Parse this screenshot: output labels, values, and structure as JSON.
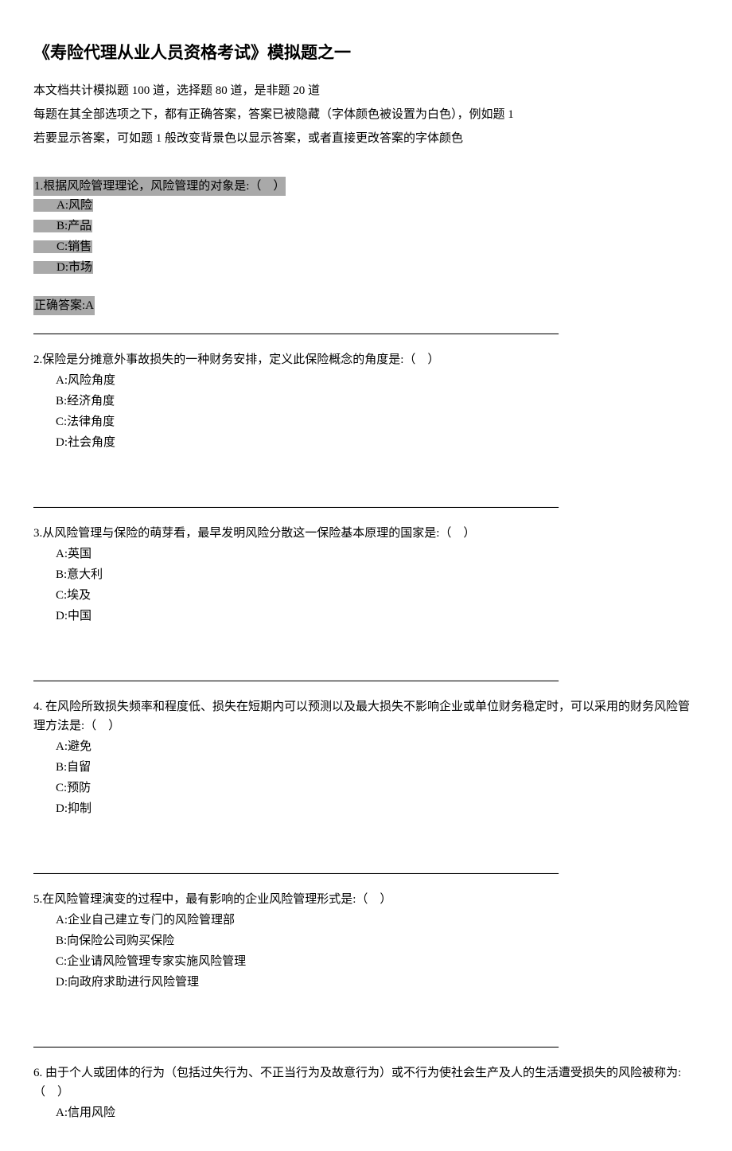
{
  "title": "《寿险代理从业人员资格考试》模拟题之一",
  "intro": {
    "line1": "本文档共计模拟题 100 道，选择题 80 道，是非题 20 道",
    "line2": "每题在其全部选项之下，都有正确答案，答案已被隐藏（字体颜色被设置为白色），例如题 1",
    "line3": "若要显示答案，可如题 1 般改变背景色以显示答案，或者直接更改答案的字体颜色"
  },
  "q1": {
    "text": "1.根据风险管理理论，风险管理的对象是:（ ）",
    "optA": "A:风险",
    "optB": "B:产品",
    "optC": "C:销售",
    "optD": "D:市场",
    "answer": "正确答案:A"
  },
  "q2": {
    "text": "2.保险是分摊意外事故损失的一种财务安排，定义此保险概念的角度是:（ ）",
    "optA": "A:风险角度",
    "optB": "B:经济角度",
    "optC": "C:法律角度",
    "optD": "D:社会角度"
  },
  "q3": {
    "text": "3.从风险管理与保险的萌芽看，最早发明风险分散这一保险基本原理的国家是:（ ）",
    "optA": "A:英国",
    "optB": "B:意大利",
    "optC": "C:埃及",
    "optD": "D:中国"
  },
  "q4": {
    "text": "4. 在风险所致损失频率和程度低、损失在短期内可以预测以及最大损失不影响企业或单位财务稳定时，可以采用的财务风险管理方法是:（ ）",
    "optA": "A:避免",
    "optB": "B:自留",
    "optC": "C:预防",
    "optD": "D:抑制"
  },
  "q5": {
    "text": "5.在风险管理演变的过程中，最有影响的企业风险管理形式是:（ ）",
    "optA": "A:企业自己建立专门的风险管理部",
    "optB": "B:向保险公司购买保险",
    "optC": "C:企业请风险管理专家实施风险管理",
    "optD": "D:向政府求助进行风险管理"
  },
  "q6": {
    "text": "6. 由于个人或团体的行为（包括过失行为、不正当行为及故意行为）或不行为使社会生产及人的生活遭受损失的风险被称为:（ ）",
    "optA": "A:信用风险"
  },
  "divider": "________________________________________________________________________________________"
}
